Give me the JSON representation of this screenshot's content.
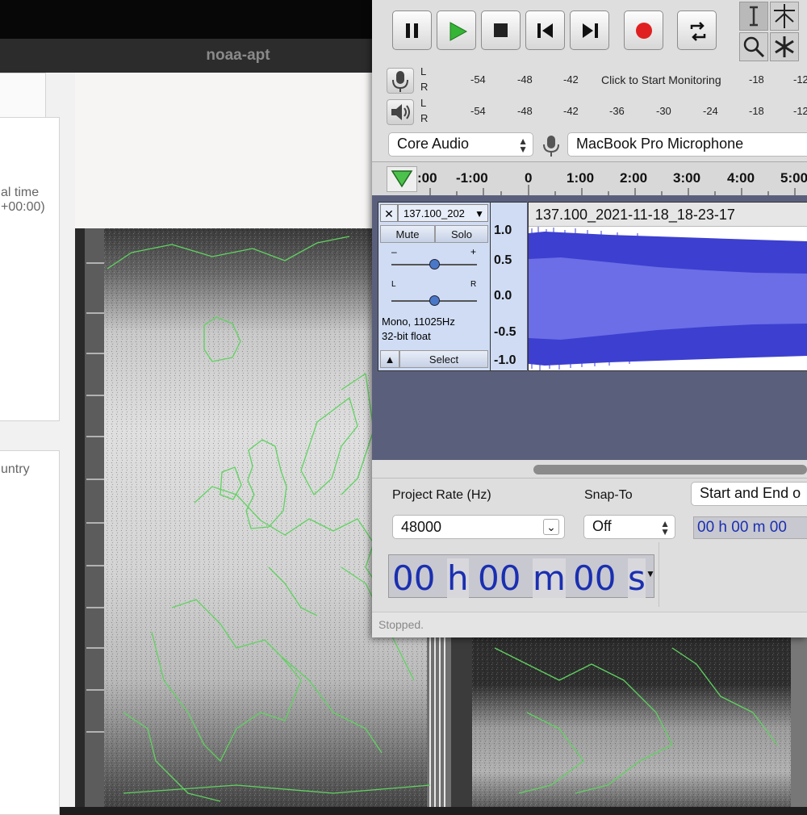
{
  "noaa": {
    "window_title": "noaa-apt",
    "left_panel": {
      "time_line1": "al time",
      "time_line2": "+00:00)",
      "country_label": "untry"
    },
    "map_outline_color": "#5fd35f"
  },
  "audacity": {
    "transport": {
      "pause": "pause-icon",
      "play": "play-icon",
      "stop": "stop-icon",
      "skip_start": "skip-to-start-icon",
      "skip_end": "skip-to-end-icon",
      "record": "record-icon",
      "loop": "loop-icon"
    },
    "tools": [
      "selection-tool-icon",
      "envelope-tool-icon",
      "zoom-tool-icon",
      "multi-tool-icon"
    ],
    "record_meter": {
      "channels": [
        "L",
        "R"
      ],
      "ticks": [
        "-54",
        "-48",
        "-42",
        "-18",
        "-12"
      ],
      "monitor_label": "Click to Start Monitoring"
    },
    "play_meter": {
      "channels": [
        "L",
        "R"
      ],
      "ticks": [
        "-54",
        "-48",
        "-42",
        "-36",
        "-30",
        "-24",
        "-18",
        "-12"
      ]
    },
    "device": {
      "host": "Core Audio",
      "input_device": "MacBook Pro Microphone"
    },
    "ruler": {
      "labels": [
        ":00",
        "-1:00",
        "0",
        "1:00",
        "2:00",
        "3:00",
        "4:00",
        "5:00"
      ]
    },
    "track": {
      "name_short": "137.100_202",
      "clip_name": "137.100_2021-11-18_18-23-17",
      "mute": "Mute",
      "solo": "Solo",
      "gain_minus": "–",
      "gain_plus": "+",
      "pan_left": "L",
      "pan_right": "R",
      "format_line1": "Mono, 11025Hz",
      "format_line2": "32-bit float",
      "select": "Select",
      "scale": [
        "1.0",
        "0.5",
        "0.0",
        "-0.5",
        "-1.0"
      ],
      "wave_color": "#3d3fd0"
    },
    "bottom": {
      "project_rate_label": "Project Rate (Hz)",
      "project_rate_value": "48000",
      "snap_label": "Snap-To",
      "snap_value": "Off",
      "selection_label": "Start and End o",
      "selection_time": "00 h 00 m 00",
      "time_h": "00",
      "time_h_unit": "h",
      "time_m": "00",
      "time_m_unit": "m",
      "time_s": "00",
      "time_s_unit": "s",
      "status": "Stopped."
    }
  }
}
